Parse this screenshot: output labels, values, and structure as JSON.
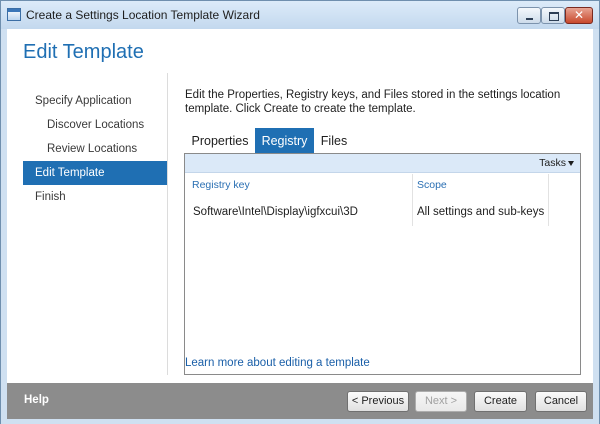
{
  "window": {
    "title": "Create a Settings Location Template Wizard"
  },
  "page": {
    "title": "Edit Template"
  },
  "steps": [
    {
      "label": "Specify Application"
    },
    {
      "label": "Discover Locations"
    },
    {
      "label": "Review Locations"
    },
    {
      "label": "Edit Template",
      "active": true
    },
    {
      "label": "Finish"
    }
  ],
  "instructions": "Edit the Properties, Registry keys, and Files stored in the settings location template. Click Create to create the template.",
  "tabs": [
    {
      "label": "Properties"
    },
    {
      "label": "Registry",
      "selected": true
    },
    {
      "label": "Files"
    }
  ],
  "grid": {
    "tasks_label": "Tasks",
    "columns": [
      "Registry key",
      "Scope"
    ],
    "rows": [
      [
        "Software\\Intel\\Display\\igfxcui\\3D",
        "All settings and sub-keys"
      ]
    ]
  },
  "learn_more": "Learn more about editing a template",
  "footer": {
    "help": "Help",
    "previous": "< Previous",
    "next": "Next >",
    "create": "Create",
    "cancel": "Cancel"
  },
  "colors": {
    "accent": "#1f6fb3",
    "footer": "#8c8c8c",
    "frame": "#cfe0f1"
  },
  "icons": {
    "app": "window-app-icon",
    "minimize": "minimize-icon",
    "maximize": "maximize-icon",
    "close": "close-icon",
    "tasks": "chevron-down-icon"
  }
}
